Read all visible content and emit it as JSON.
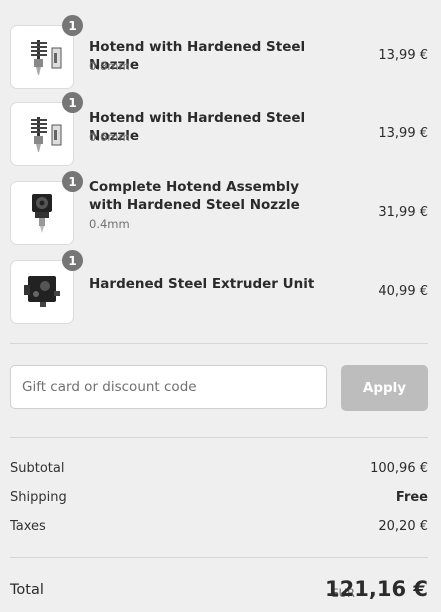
{
  "items": [
    {
      "quantity": "1",
      "name": "Hotend with Hardened Steel Nozzle",
      "variant": "0.8mm",
      "price": "13,99 €",
      "image_icon": "hotend-icon"
    },
    {
      "quantity": "1",
      "name": "Hotend with Hardened Steel Nozzle",
      "variant": "0.6mm",
      "price": "13,99 €",
      "image_icon": "hotend-icon"
    },
    {
      "quantity": "1",
      "name": "Complete Hotend Assembly with Hardened Steel Nozzle",
      "variant": "0.4mm",
      "price": "31,99 €",
      "image_icon": "hotend-assembly-icon"
    },
    {
      "quantity": "1",
      "name": "Hardened Steel Extruder Unit",
      "variant": "",
      "price": "40,99 €",
      "image_icon": "extruder-icon"
    }
  ],
  "discount": {
    "placeholder": "Gift card or discount code",
    "value": "",
    "apply_label": "Apply"
  },
  "summary": {
    "subtotal_label": "Subtotal",
    "subtotal_value": "100,96 €",
    "shipping_label": "Shipping",
    "shipping_value": "Free",
    "taxes_label": "Taxes",
    "taxes_value": "20,20 €"
  },
  "total": {
    "label": "Total",
    "currency": "EUR",
    "value": "121,16 €"
  },
  "colors": {
    "background": "#efefef",
    "badge": "#767676",
    "apply_button": "#bdbdbd",
    "text": "#2b2b2b",
    "muted": "#707070"
  }
}
